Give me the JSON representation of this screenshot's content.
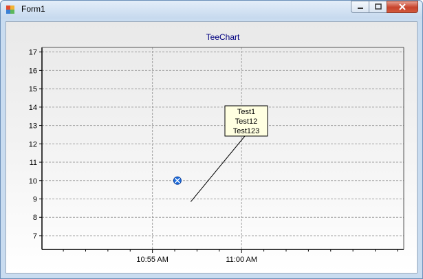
{
  "window": {
    "title": "Form1"
  },
  "chart_data": {
    "type": "scatter",
    "title": "TeeChart",
    "xlabel": "",
    "ylabel": "",
    "ylim": [
      6.25,
      17.25
    ],
    "y_ticks": [
      7,
      8,
      9,
      10,
      11,
      12,
      13,
      14,
      15,
      16,
      17
    ],
    "x_ticks": [
      "10:55 AM",
      "11:00 AM"
    ],
    "x_range_minutes": [
      -6.2,
      14.1
    ],
    "grid": true,
    "legend": "none",
    "points": [
      {
        "x": "10:56 AM",
        "x_min": 1.4,
        "y": 10
      }
    ],
    "annotation": {
      "lines": [
        "Test1",
        "Test12",
        "Test123"
      ],
      "pointer_from": {
        "x_min": 2.15,
        "y": 8.85
      }
    },
    "colors": {
      "title": "#000080",
      "point": "#1e6fe0",
      "grid": "#a0a0a0"
    }
  }
}
